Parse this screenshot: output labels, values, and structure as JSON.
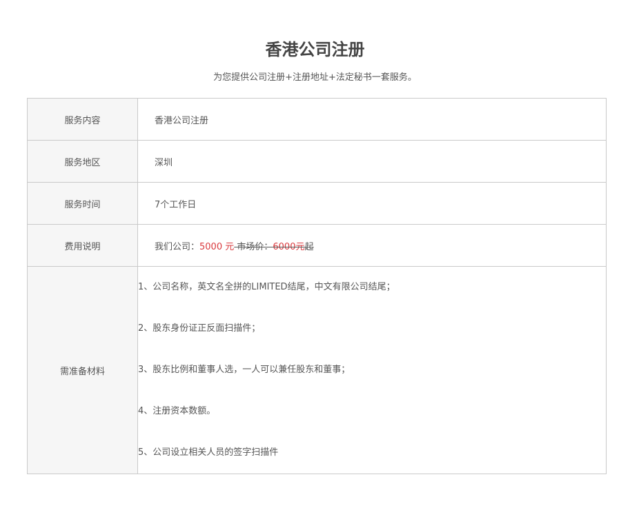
{
  "header": {
    "title": "香港公司注册",
    "subtitle": "为您提供公司注册+注册地址+法定秘书一套服务。"
  },
  "rows": [
    {
      "label": "服务内容",
      "value": "香港公司注册"
    },
    {
      "label": "服务地区",
      "value": "深圳"
    },
    {
      "label": "服务时间",
      "value": "7个工作日"
    }
  ],
  "fee": {
    "label": "费用说明",
    "prefix": "我们公司：",
    "price": "5000 元",
    "market_label": "市场价：",
    "market_price": "6000元",
    "suffix": "起"
  },
  "materials": {
    "label": "需准备材料",
    "items": [
      "1、公司名称，英文名全拼的LIMITED结尾，中文有限公司结尾；",
      "2、股东身份证正反面扫描件；",
      "3、股东比例和董事人选，一人可以兼任股东和董事；",
      "4、注册资本数额。",
      "5、公司设立相关人员的签字扫描件"
    ]
  },
  "colors": {
    "price_red": "#d9383c",
    "border": "#c9c9c9",
    "label_bg": "#f6f6f6"
  }
}
